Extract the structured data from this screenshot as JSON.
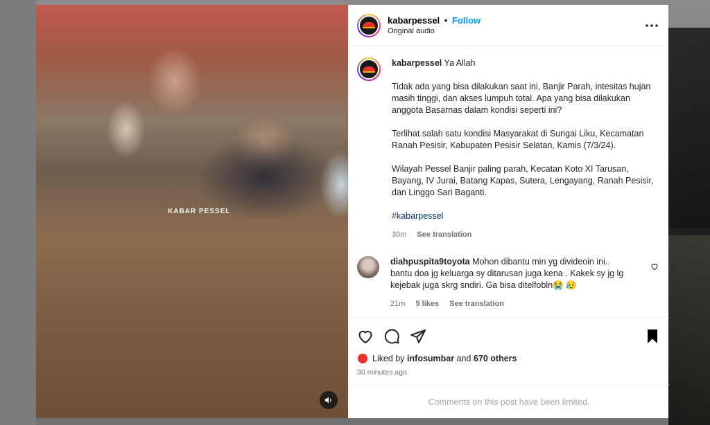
{
  "post": {
    "username": "kabarpessel",
    "follow_label": "Follow",
    "separator": "•",
    "subtitle": "Original audio",
    "watermark": "KABAR PESSEL"
  },
  "caption": {
    "username": "kabarpessel",
    "first_line": "Ya Allah",
    "paragraphs": [
      "Tidak ada yang bisa dilakukan saat ini, Banjir Parah, intesitas hujan masih tinggi, dan akses lumpuh total. Apa yang bisa dilakukan anggota Basarnas dalam kondisi seperti ini?",
      "Terlihat salah satu kondisi Masyarakat di Sungai Liku, Kecamatan Ranah Pesisir, Kabupaten Pesisir Selatan, Kamis (7/3/24).",
      "Wilayah Pessel Banjir paling parah, Kecatan Koto XI Tarusan, Bayang, IV Jurai, Batang Kapas, Sutera, Lengayang, Ranah Pesisir, dan Linggo Sari Baganti."
    ],
    "hashtag": "#kabarpessel",
    "time": "30m",
    "see_translation": "See translation"
  },
  "comment": {
    "username": "diahpuspita9toyota",
    "text": "Mohon dibantu min yg divideoin ini.. bantu doa jg keluarga sy ditarusan juga kena . Kakek sy jg lg kejebak juga skrg sndiri. Ga bisa ditelfobln😭 😥",
    "time": "21m",
    "likes": "5 likes",
    "see_translation": "See translation"
  },
  "likes": {
    "prefix": "Liked by",
    "user": "infosumbar",
    "and": "and",
    "others": "670 others"
  },
  "timestamp": "30 minutes ago",
  "comments_limited": "Comments on this post have been limited.",
  "colors": {
    "follow": "#0095f6",
    "brand_red": "#e8332a"
  },
  "icons": [
    "more-icon",
    "heart-icon",
    "comment-icon",
    "share-icon",
    "bookmark-icon",
    "audio-icon",
    "comment-heart-icon"
  ]
}
